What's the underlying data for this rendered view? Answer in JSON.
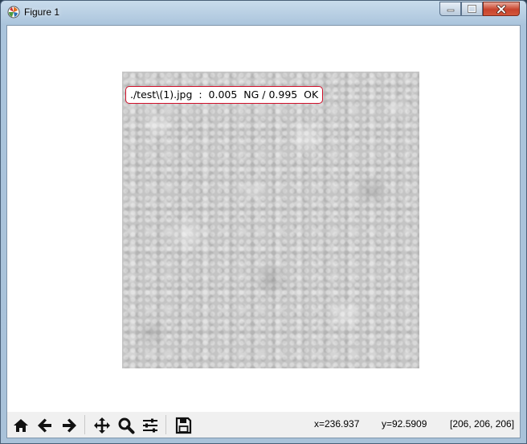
{
  "window": {
    "title": "Figure 1"
  },
  "figure": {
    "title_text": "./test\\(1).jpg  :  0.005  NG / 0.995  OK",
    "title_border_color": "#d0102a",
    "image_description_color": "#c4c4c4"
  },
  "toolbar": {
    "buttons": [
      {
        "name": "home",
        "icon": "home-icon"
      },
      {
        "name": "back",
        "icon": "arrow-left-icon"
      },
      {
        "name": "forward",
        "icon": "arrow-right-icon"
      },
      {
        "name": "pan",
        "icon": "move-icon"
      },
      {
        "name": "zoom",
        "icon": "magnifier-icon"
      },
      {
        "name": "subplots",
        "icon": "sliders-icon"
      },
      {
        "name": "save",
        "icon": "floppy-icon"
      }
    ]
  },
  "status": {
    "x": "x=236.937",
    "y": "y=92.5909",
    "pixel": "[206, 206, 206]"
  }
}
